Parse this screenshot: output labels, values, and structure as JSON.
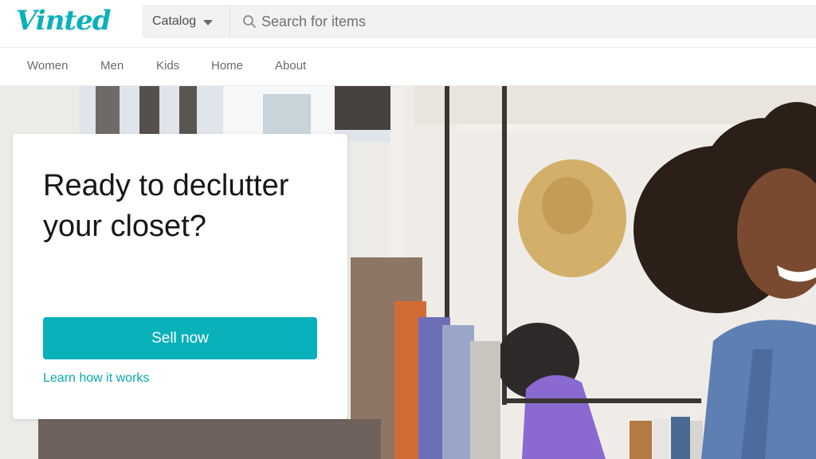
{
  "header": {
    "logo_text": "Vinted",
    "catalog_label": "Catalog",
    "search_placeholder": "Search for items"
  },
  "nav": {
    "items": [
      {
        "label": "Women"
      },
      {
        "label": "Men"
      },
      {
        "label": "Kids"
      },
      {
        "label": "Home"
      },
      {
        "label": "About"
      }
    ]
  },
  "hero": {
    "title": "Ready to declutter your closet?",
    "sell_button": "Sell now",
    "learn_link": "Learn how it works"
  },
  "colors": {
    "brand": "#09B1BA",
    "text_dark": "#171717",
    "nav_text": "#6b6b6b"
  }
}
